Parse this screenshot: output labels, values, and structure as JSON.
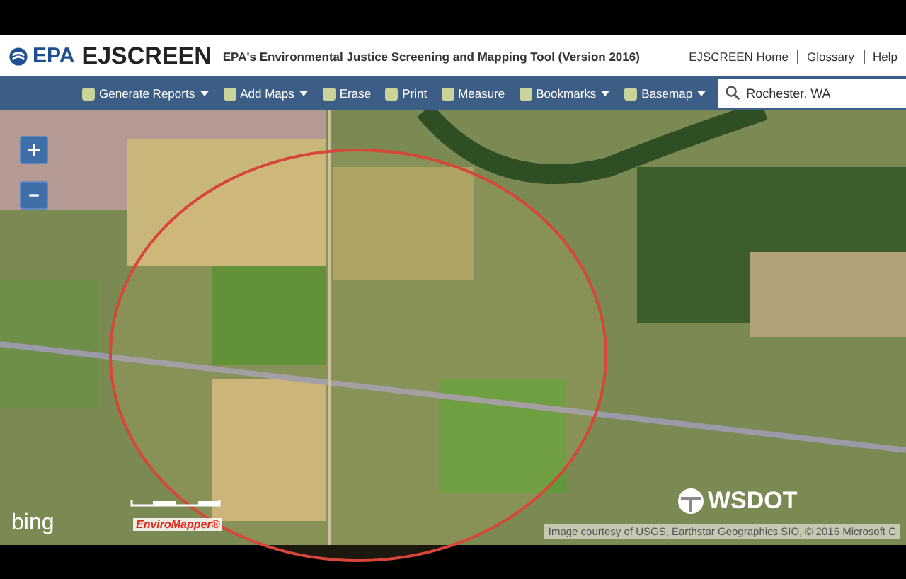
{
  "header": {
    "logo": "EPA",
    "title": "EJSCREEN",
    "subtitle": "EPA's Environmental Justice Screening and Mapping Tool (Version 2016)",
    "links": [
      "EJSCREEN Home",
      "Glossary",
      "Help"
    ]
  },
  "toolbar": [
    {
      "label": "Generate Reports",
      "has_menu": true
    },
    {
      "label": "Add Maps",
      "has_menu": true
    },
    {
      "label": "Erase",
      "has_menu": false
    },
    {
      "label": "Print",
      "has_menu": false
    },
    {
      "label": "Measure",
      "has_menu": false
    },
    {
      "label": "Bookmarks",
      "has_menu": true
    },
    {
      "label": "Basemap",
      "has_menu": true
    }
  ],
  "search": {
    "value": "Rochester, WA"
  },
  "map": {
    "bing": "bing",
    "enviromapper": "EnviroMapper®",
    "wsdot": "WSDOT",
    "attribution": "Image courtesy of USGS, Earthstar Geographics SIO, © 2016 Microsoft C"
  }
}
